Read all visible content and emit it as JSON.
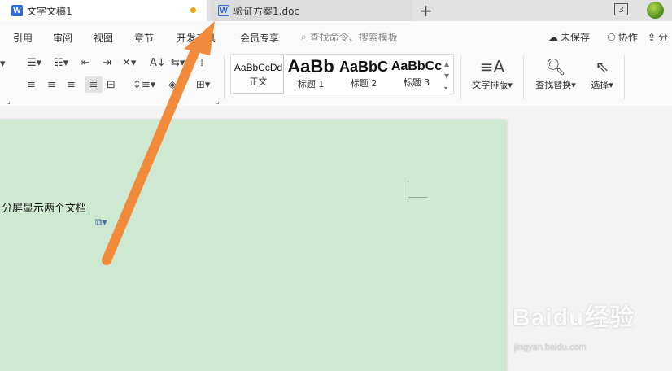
{
  "tabs": [
    {
      "label": "文字文稿1",
      "icon": "W"
    },
    {
      "label": "验证方案1.doc",
      "icon": "W"
    }
  ],
  "tabbar": {
    "plus": "+",
    "window_count": "3"
  },
  "menu": {
    "items": [
      "引用",
      "审阅",
      "视图",
      "章节",
      "开发工具",
      "会员专享"
    ],
    "search_placeholder": "查找命令、搜索模板",
    "unsaved": "未保存",
    "collab": "协作",
    "share": "分"
  },
  "ribbon": {
    "styles": [
      {
        "preview": "AaBbCcDd",
        "name": "正文"
      },
      {
        "preview": "AaBb",
        "name": "标题 1"
      },
      {
        "preview": "AaBbC",
        "name": "标题 2"
      },
      {
        "preview": "AaBbCc",
        "name": "标题 3"
      }
    ],
    "text_layout": "文字排版",
    "find_replace": "查找替换",
    "select": "选择"
  },
  "document": {
    "text": "分屏显示两个文档"
  },
  "watermark": {
    "brand": "Baidu经验",
    "url": "jingyan.baidu.com"
  },
  "colors": {
    "arrow": "#f28a3c",
    "page": "#cde9d2",
    "accent": "#2f6bd9",
    "unsaved_dot": "#e8a300"
  }
}
